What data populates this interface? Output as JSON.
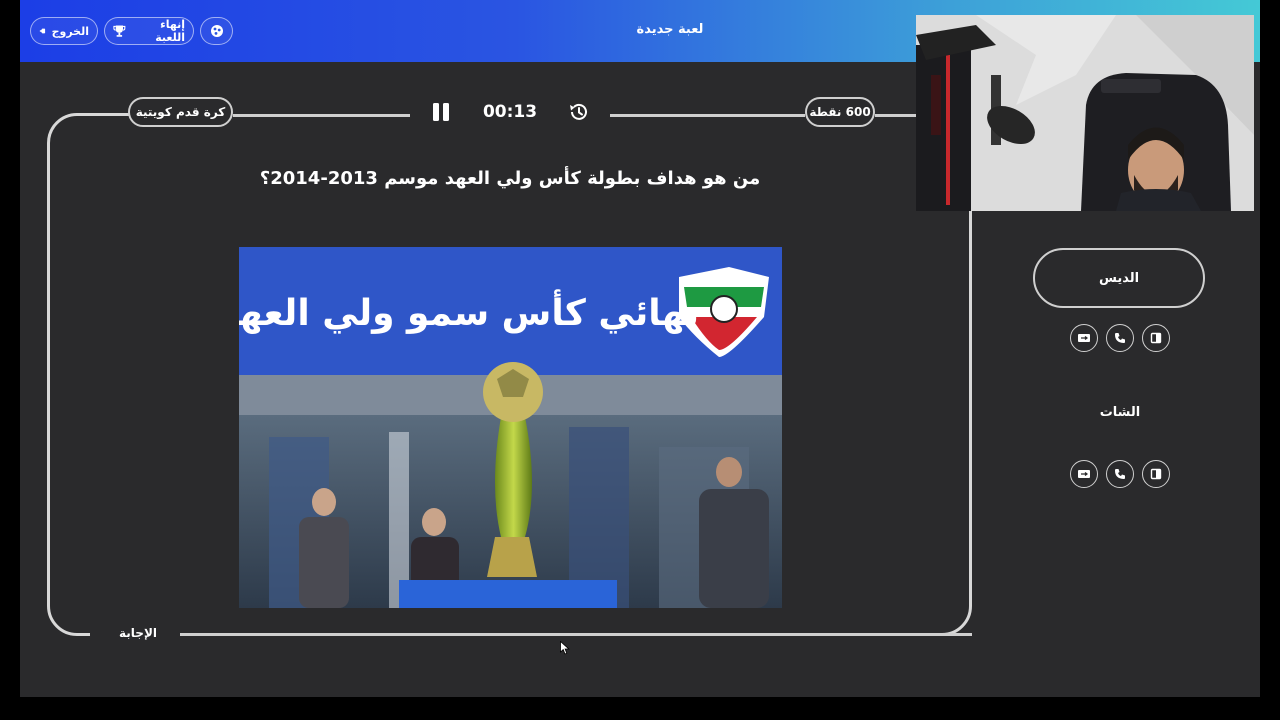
{
  "header": {
    "exit_label": "الخروج",
    "end_game_label": "إنهاء اللعبة",
    "new_game_label": "لعبة جديدة",
    "share_icon": "share-icon",
    "exit_icon": "exit-icon",
    "trophy_icon": "trophy-icon"
  },
  "question_panel": {
    "category": "كرة قدم كويتية",
    "points": "600 نقطة",
    "timer": "00:13",
    "question": "من هو هداف بطولة كأس ولي العهد موسم 2013-2014؟",
    "answer_label": "الإجابة",
    "image_banner_text": "نهائي كأس سمو ولي العهد"
  },
  "teams": [
    {
      "name": "الديس",
      "aid_icons": [
        "swap-icon",
        "phone-icon",
        "split-icon"
      ]
    },
    {
      "name": "الشات",
      "aid_icons": [
        "swap-icon",
        "phone-icon",
        "split-icon"
      ]
    }
  ],
  "colors": {
    "header_gradient_start": "#1c3ee6",
    "header_gradient_end": "#44c9d6",
    "background": "#2a2a2c",
    "frame": "#d8d8d8"
  }
}
